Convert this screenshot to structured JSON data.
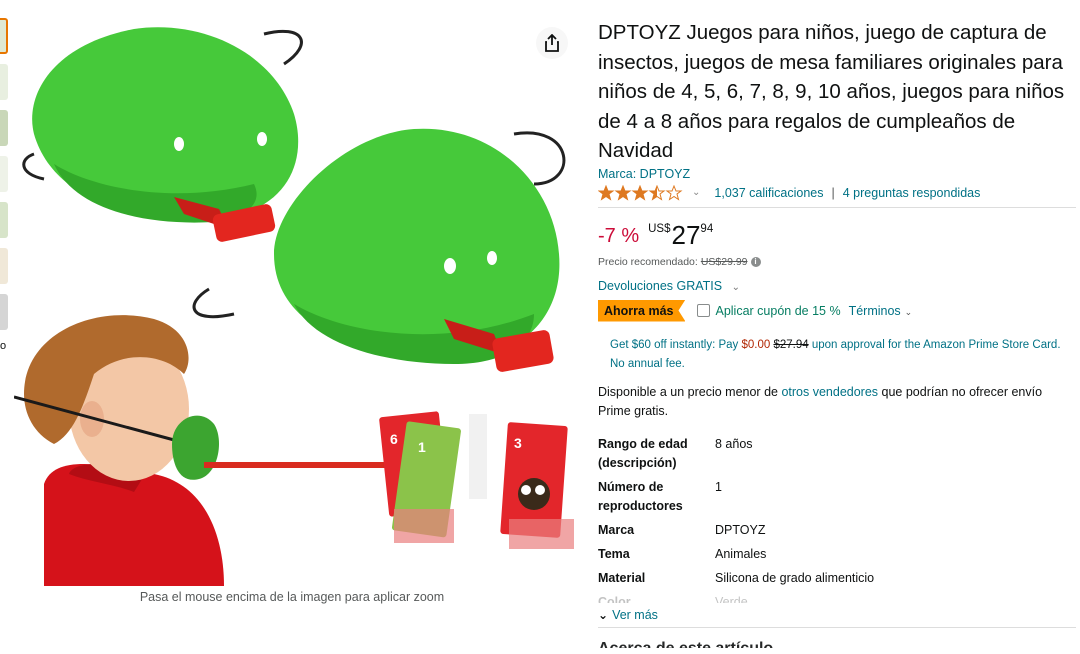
{
  "thumbnails": {
    "colors": [
      "#dfe9d3",
      "#e8efe0",
      "#c9d7b8",
      "#eef2e8",
      "#d7e4c9",
      "#f0e8d8",
      "#d5d5d5"
    ],
    "video_label": "o"
  },
  "image": {
    "zoom_hint": "Pasa el mouse encima de la imagen para aplicar zoom",
    "card_left_number": "6",
    "card_mid_number": "1",
    "card_right_number": "3"
  },
  "product": {
    "title": "DPTOYZ Juegos para niños, juego de captura de insectos, juegos de mesa familiares originales para niños de 4, 5, 6, 7, 8, 9, 10 años, juegos para niños de 4 a 8 años para regalos de cumpleaños de Navidad",
    "brand": "Marca: DPTOYZ",
    "rating_stars": 3.5,
    "ratings_count": "1,037 calificaciones",
    "questions": "4 preguntas respondidas"
  },
  "price": {
    "discount": "-7 %",
    "currency": "US$",
    "whole": "27",
    "fraction": "94",
    "list_price_label": "Precio recomendado:",
    "list_price": "US$29.99"
  },
  "returns": "Devoluciones GRATIS",
  "coupon": {
    "badge": "Ahorra más",
    "label": "Aplicar cupón de 15 %",
    "terms": "Términos"
  },
  "promo": {
    "part1": "Get $60 off instantly: Pay ",
    "pay": "$0.00",
    "space": " ",
    "original": "$27.94",
    "part2": " upon approval for the Amazon Prime Store Card. No annual fee."
  },
  "other_sellers": {
    "part1": "Disponible a un precio menor de ",
    "link": "otros vendedores",
    "part2": " que podrían no ofrecer envío Prime gratis."
  },
  "specs": [
    {
      "key": "Rango de edad (descripción)",
      "value": "8 años"
    },
    {
      "key": "Número de reproductores",
      "value": "1"
    },
    {
      "key": "Marca",
      "value": "DPTOYZ"
    },
    {
      "key": "Tema",
      "value": "Animales"
    },
    {
      "key": "Material",
      "value": "Silicona de grado alimenticio"
    },
    {
      "key": "Color",
      "value": "Verde"
    }
  ],
  "see_more": "Ver más",
  "next_section_heading": "Acerca de este artículo",
  "colors": {
    "link": "#007185",
    "discount": "#cc0c39",
    "badge": "#ff9900",
    "coupon_green": "#067d62",
    "frog_green": "#46c93a",
    "tongue_red": "#e3261f"
  }
}
